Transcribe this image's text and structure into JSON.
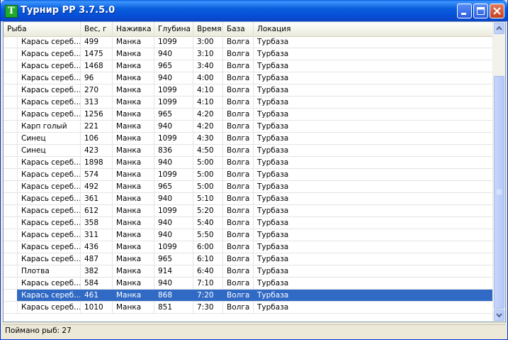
{
  "window": {
    "title": "Турнир РР 3.7.5.0"
  },
  "columns": [
    "Рыба",
    "Вес, г",
    "Наживка",
    "Глубина",
    "Время",
    "База",
    "Локация"
  ],
  "rows": [
    [
      "Карась сереб…",
      "499",
      "Манка",
      "1099",
      "3:00",
      "Волга",
      "Турбаза"
    ],
    [
      "Карась сереб…",
      "1475",
      "Манка",
      "940",
      "3:10",
      "Волга",
      "Турбаза"
    ],
    [
      "Карась сереб…",
      "1468",
      "Манка",
      "965",
      "3:40",
      "Волга",
      "Турбаза"
    ],
    [
      "Карась сереб…",
      "96",
      "Манка",
      "940",
      "4:00",
      "Волга",
      "Турбаза"
    ],
    [
      "Карась сереб…",
      "270",
      "Манка",
      "1099",
      "4:10",
      "Волга",
      "Турбаза"
    ],
    [
      "Карась сереб…",
      "313",
      "Манка",
      "1099",
      "4:10",
      "Волга",
      "Турбаза"
    ],
    [
      "Карась сереб…",
      "1256",
      "Манка",
      "965",
      "4:20",
      "Волга",
      "Турбаза"
    ],
    [
      "Карп голый",
      "221",
      "Манка",
      "940",
      "4:20",
      "Волга",
      "Турбаза"
    ],
    [
      "Синец",
      "106",
      "Манка",
      "1099",
      "4:30",
      "Волга",
      "Турбаза"
    ],
    [
      "Синец",
      "423",
      "Манка",
      "836",
      "4:50",
      "Волга",
      "Турбаза"
    ],
    [
      "Карась сереб…",
      "1898",
      "Манка",
      "940",
      "5:00",
      "Волга",
      "Турбаза"
    ],
    [
      "Карась сереб…",
      "574",
      "Манка",
      "1099",
      "5:00",
      "Волга",
      "Турбаза"
    ],
    [
      "Карась сереб…",
      "492",
      "Манка",
      "965",
      "5:00",
      "Волга",
      "Турбаза"
    ],
    [
      "Карась сереб…",
      "361",
      "Манка",
      "940",
      "5:10",
      "Волга",
      "Турбаза"
    ],
    [
      "Карась сереб…",
      "612",
      "Манка",
      "1099",
      "5:20",
      "Волга",
      "Турбаза"
    ],
    [
      "Карась сереб…",
      "358",
      "Манка",
      "940",
      "5:40",
      "Волга",
      "Турбаза"
    ],
    [
      "Карась сереб…",
      "311",
      "Манка",
      "940",
      "5:50",
      "Волга",
      "Турбаза"
    ],
    [
      "Карась сереб…",
      "436",
      "Манка",
      "1099",
      "6:00",
      "Волга",
      "Турбаза"
    ],
    [
      "Карась сереб…",
      "487",
      "Манка",
      "965",
      "6:10",
      "Волга",
      "Турбаза"
    ],
    [
      "Плотва",
      "382",
      "Манка",
      "914",
      "6:40",
      "Волга",
      "Турбаза"
    ],
    [
      "Карась сереб…",
      "584",
      "Манка",
      "940",
      "7:10",
      "Волга",
      "Турбаза"
    ],
    [
      "Карась сереб…",
      "461",
      "Манка",
      "868",
      "7:20",
      "Волга",
      "Турбаза"
    ],
    [
      "Карась сереб…",
      "1010",
      "Манка",
      "851",
      "7:30",
      "Волга",
      "Турбаза"
    ]
  ],
  "selected_row_index": 21,
  "status": {
    "text": "Поймано рыб: 27"
  },
  "colors": {
    "selection": "#316ac5",
    "titlebar": "#0a5fdc",
    "app_icon": "#1faa2a"
  },
  "icons": {
    "app": "app-icon-green-t",
    "minimize": "minimize-icon",
    "maximize": "maximize-icon",
    "close": "close-icon"
  }
}
